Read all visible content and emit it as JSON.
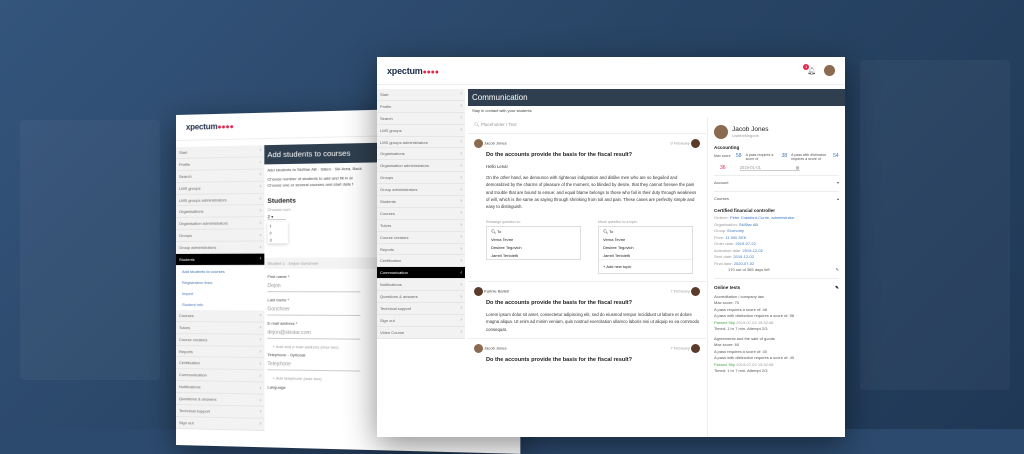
{
  "back": {
    "logo": "xpectum",
    "logo_dots": "●●●●",
    "page_title": "Add students to courses",
    "subtitle": "Add students to SkiStar AB · Sälen · Ski Area, Back",
    "instruction1": "Choose number of students to add and fill in al",
    "instruction2": "Choose one or several courses and start date f",
    "students_heading": "Students",
    "choose_num": "Choose num",
    "num_value": "2",
    "num_options": [
      "1",
      "2",
      "3"
    ],
    "student_row": "Student 1 - Dejon Gonchner",
    "first_name_label": "First name *",
    "first_name_value": "Dejon",
    "last_name_label": "Last name *",
    "last_name_value": "Gonchner",
    "email_label": "E-mail address *",
    "email_value": "dejon@skistar.com",
    "add_email": "Add and e-mail address (max two)",
    "phone_label": "Telephone - Optional",
    "phone_value": "Telephone",
    "add_phone": "Add telephone (max two)",
    "language_label": "Language",
    "sidebar": [
      "Start",
      "Profile",
      "Search",
      "LMS groups",
      "LMS groups administrators",
      "Organisations",
      "Organisation administrators",
      "Groups",
      "Group administrators"
    ],
    "sidebar_active": "Students",
    "sidebar_sub": [
      "Add students to courses",
      "Registration links",
      "Import",
      "Student info"
    ],
    "sidebar_rest": [
      "Courses",
      "Tutors",
      "Course creators",
      "Reports",
      "Certification",
      "Communication",
      "Notifications",
      "Questions & answers",
      "Technical support",
      "Sign out"
    ]
  },
  "front": {
    "logo": "xpectum",
    "logo_dots": "●●●●",
    "notif_count": "1",
    "page_title": "Communication",
    "page_subtitle": "Stay in contact with your students",
    "placeholder": "Placeholder / Text",
    "sidebar": [
      "Start",
      "Profile",
      "Search",
      "LMS groups",
      "LMS groups administrators",
      "Organisations",
      "Organisation administrators",
      "Groups",
      "Group administrators",
      "Students",
      "Courses",
      "Tutors",
      "Course creators",
      "Reports",
      "Certification"
    ],
    "sidebar_active": "Communication",
    "sidebar_rest": [
      "Notifications",
      "Questions & answers",
      "Technical support",
      "Sign out",
      "Video Course"
    ],
    "posts": [
      {
        "author": "Jacob Jones",
        "date": "9 February",
        "question": "Do the accounts provide the basis for the fiscal result?",
        "greeting": "Hello Lena!",
        "body": "On the other hand, we denounce with righteous indignation and dislike men who are so beguiled and demoralized by the charms of pleasure of the moment, so blinded by desire, that they cannot foresee the pain and trouble that are bound to ensue; and equal blame belongs to those who fail in their duty through weakness of will, which is the same as saying through shrinking from toil and pain. These cases are perfectly simple and easy to distinguish."
      },
      {
        "author": "Karlnie Bartell",
        "date": "7 February",
        "question": "Do the accounts provide the basis for the fiscal result?",
        "body": "Lorem ipsum dolor sit amet, consectetur adipiscing elit, sed do eiusmod tempor incididunt ut labore et dolore magna aliqua. Ut enim ad minim veniam, quis nostrud exercitation ullamco laboris nisi ut aliquip ex ea commodo consequat."
      },
      {
        "author": "Jacob Jones",
        "date": "7 February",
        "question": "Do the accounts provide the basis for the fiscal result?"
      }
    ],
    "reassign_label": "Reassign question to:",
    "move_label": "Move question to a topic:",
    "search_to": "To",
    "reassign_names": [
      "Verna Tevne",
      "Desiree Tegovich",
      "Jarrell Tertoletti"
    ],
    "move_names": [
      "Verna Tevne",
      "Desiree Tegovich",
      "Jarrell Tertoletti"
    ],
    "add_topic": "+ Add new topic",
    "profile": {
      "name": "Jacob Jones",
      "sub": "Liseltrekingone",
      "accounting": "Accounting",
      "max_score_label": "Max score",
      "max_score": "58",
      "pass_req_label": "A pass requires a score of",
      "pass_req": "38",
      "distinction_label": "A pass with distinction requires a score of",
      "distinction": "54",
      "score": "36",
      "date": "2019-01-01",
      "account_label": "Account",
      "courses_label": "Courses",
      "course_title": "Certified financial controller",
      "course_rows": [
        [
          "Orderer:",
          "Peter Crawford-Currie, administrator"
        ],
        [
          "Organisation:",
          "SkiStar AB"
        ],
        [
          "Group:",
          "Economy"
        ],
        [
          "Price:",
          "11 900 SEK"
        ],
        [
          "Order date:",
          "2019-07-22"
        ],
        [
          "Activation date:",
          "2019-12-02"
        ],
        [
          "Sent date:",
          "2019-12-02"
        ],
        [
          "Final date:",
          "2020-07-02"
        ]
      ],
      "days_left": "170 out of 365 days left",
      "online_tests": "Online tests",
      "test1_title": "Accreditation / company law",
      "test1_max": "Max score: 70",
      "test1_pass": "A pass requires a score of: 48",
      "test1_dist": "A pass with distinction requires a score of: 56",
      "test1_passed": "Passed 56p",
      "test1_passed_date": "2019-07-02 15:32:08",
      "test1_timed": "Timed: 1 hr 7 min. Attempt 2/3",
      "test2_title": "Agreements and the sale of goods",
      "test2_max": "Max score: 60",
      "test2_pass": "A pass requires a score of: 40",
      "test2_dist": "A pass with distinction requires a score of: 40",
      "test2_passed": "Passed 56p",
      "test2_passed_date": "2019-07-02 15:32:08",
      "test2_timed": "Timed: 1 hr 7 min. Attempt 2/3"
    }
  }
}
